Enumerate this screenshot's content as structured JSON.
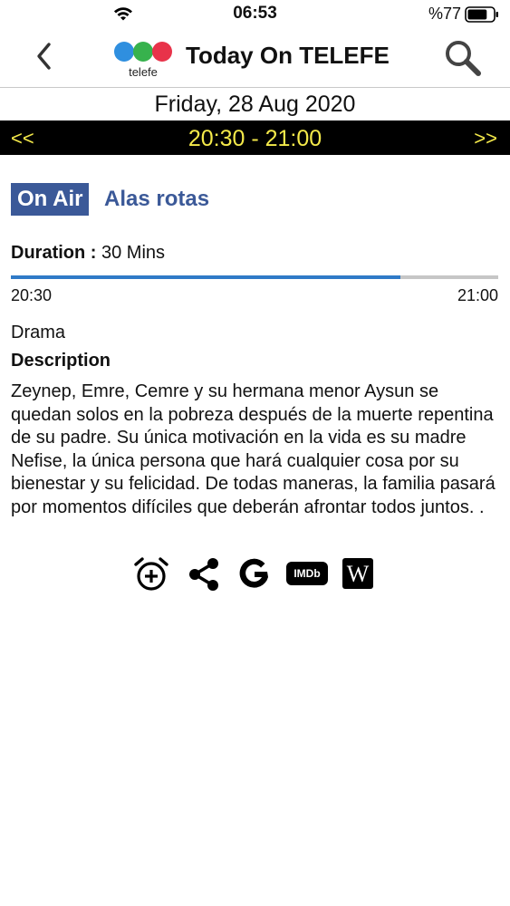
{
  "status_bar": {
    "time": "06:53",
    "battery_text": "%77",
    "battery_level": 0.77
  },
  "nav": {
    "title": "Today On TELEFE",
    "logo_text": "telefe",
    "back_icon": "chevron-left-icon",
    "search_icon": "search-icon"
  },
  "schedule": {
    "date": "Friday, 28 Aug 2020",
    "prev_label": "<<",
    "next_label": ">>",
    "time_range": "20:30 - 21:00"
  },
  "program": {
    "badge": "On Air",
    "title": "Alas rotas",
    "duration_label": "Duration :",
    "duration_value": "30 Mins",
    "progress": 0.8,
    "start_time": "20:30",
    "end_time": "21:00",
    "genre": "Drama",
    "description_heading": "Description",
    "description": "Zeynep, Emre, Cemre y su hermana menor Aysun se quedan solos en la pobreza después de la muerte repentina de su padre. Su única motivación en la vida es su madre Nefise, la única persona que hará cualquier cosa por su bienestar y su felicidad. De todas maneras, la familia pasará por momentos difíciles que deberán afrontar todos juntos. ."
  },
  "actions": {
    "alarm_icon": "alarm-add-icon",
    "share_icon": "share-icon",
    "google_icon": "google-icon",
    "imdb_label": "IMDb",
    "wiki_label": "W"
  },
  "colors": {
    "accent": "#3b5998",
    "time_text": "#f4e94a",
    "progress": "#2f7ac7",
    "logo_blue": "#2f8fdf",
    "logo_green": "#37b24d",
    "logo_red": "#e8334a"
  }
}
